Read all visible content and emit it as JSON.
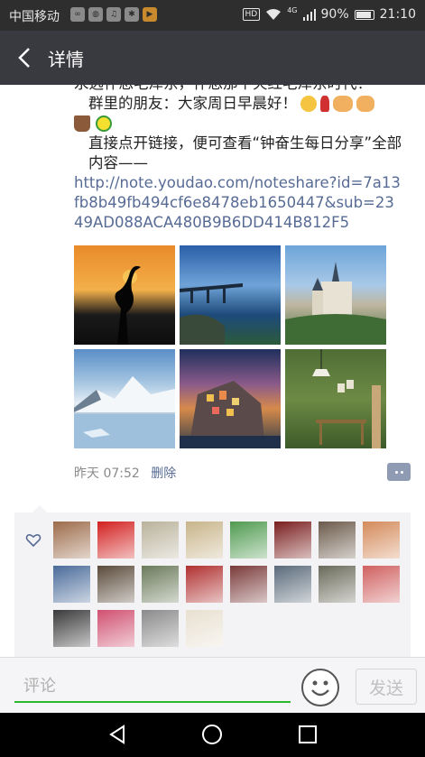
{
  "status_bar": {
    "carrier": "中国移动",
    "network": "4G",
    "battery": "90%",
    "time": "21:10",
    "hd_label": "HD",
    "icons": [
      "loop-icon",
      "baidu-icon",
      "music-icon",
      "paw-icon",
      "video-icon",
      "hd-icon",
      "wifi-icon",
      "signal-icon",
      "battery-icon"
    ]
  },
  "header": {
    "back_icon": "chevron-left-icon",
    "title": "详情"
  },
  "post": {
    "line_top": "永远怀念毛泽东，怀念那个火红毛泽东时代！",
    "greeting": "群里的朋友：大家周日早晨好！",
    "greeting_emojis": [
      "smile-emoji",
      "rose-emoji",
      "handshake-emoji",
      "pray-emoji"
    ],
    "second_emojis": [
      "coffee-emoji",
      "smiley-character-emoji"
    ],
    "instruction": "直接点开链接，便可查看“钟奋生每日分享”全部内容——",
    "link": "http://note.youdao.com/noteshare?id=7a13fb8b49fb494cf6e8478eb1650447&sub=2349AD088ACA480B9B6DD414B812F5",
    "photos": [
      {
        "subject": "heron at sunset"
      },
      {
        "subject": "coastal bridge"
      },
      {
        "subject": "castle"
      },
      {
        "subject": "snow mountain lake"
      },
      {
        "subject": "cliffside village at dusk"
      },
      {
        "subject": "green interior"
      }
    ],
    "time": "昨天 07:52",
    "delete_label": "删除"
  },
  "likes": {
    "icon": "heart-outline-icon",
    "avatar_colors": [
      "#9c6b4a",
      "#d32020",
      "#b9b29b",
      "#c8b48a",
      "#4f9a4f",
      "#7a1e1e",
      "#6b5a4a",
      "#d48a5a",
      "#4a6b9a",
      "#5a4a3a",
      "#6a7a5a",
      "#b03030",
      "#7a3a3a",
      "#5a6a7a",
      "#6a6a5a",
      "#d06060",
      "#3a3a3a",
      "#d05070",
      "#8a8a8a",
      "#e8e0d0"
    ]
  },
  "input_bar": {
    "placeholder": "评论",
    "emoji_icon": "smiley-face-icon",
    "send_label": "发送"
  },
  "nav_bar": {
    "icons": [
      "back-triangle-icon",
      "home-circle-icon",
      "recents-square-icon"
    ]
  }
}
